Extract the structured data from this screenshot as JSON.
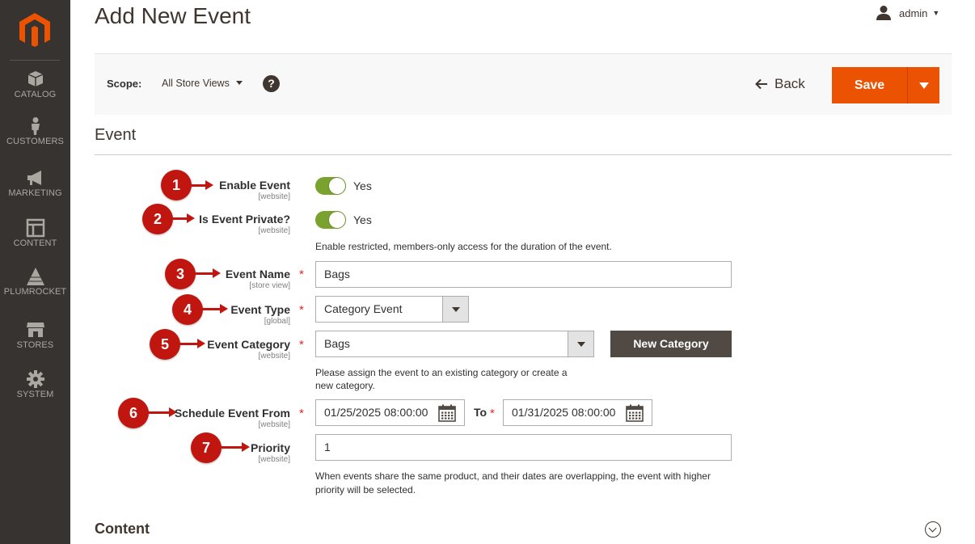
{
  "sidebar": {
    "items": [
      {
        "label": "CATALOG",
        "icon": "catalog-box-icon"
      },
      {
        "label": "CUSTOMERS",
        "icon": "customers-person-icon"
      },
      {
        "label": "MARKETING",
        "icon": "marketing-megaphone-icon"
      },
      {
        "label": "CONTENT",
        "icon": "content-layout-icon"
      },
      {
        "label": "PLUMROCKET",
        "icon": "plumrocket-pyramid-icon"
      },
      {
        "label": "STORES",
        "icon": "stores-shop-icon"
      },
      {
        "label": "SYSTEM",
        "icon": "system-gear-icon"
      }
    ],
    "colors": {
      "bg": "#373330",
      "logo": "#eb5202"
    }
  },
  "header": {
    "title": "Add New Event",
    "user": "admin"
  },
  "scope_bar": {
    "label": "Scope:",
    "value": "All Store Views",
    "back_label": "Back",
    "save_label": "Save"
  },
  "section": {
    "title": "Event"
  },
  "fields": {
    "enable_event": {
      "badge": "1",
      "label": "Enable Event",
      "scope": "[website]",
      "value": "Yes"
    },
    "is_private": {
      "badge": "2",
      "label": "Is Event Private?",
      "scope": "[website]",
      "value": "Yes",
      "note": "Enable restricted, members-only access for the duration of the event."
    },
    "event_name": {
      "badge": "3",
      "label": "Event Name",
      "scope": "[store view]",
      "value": "Bags"
    },
    "event_type": {
      "badge": "4",
      "label": "Event Type",
      "scope": "[global]",
      "value": "Category Event"
    },
    "event_category": {
      "badge": "5",
      "label": "Event Category",
      "scope": "[website]",
      "value": "Bags",
      "button": "New Category",
      "note_line1": "Please assign the event to an existing category or create a",
      "note_line2": "new category."
    },
    "schedule": {
      "badge": "6",
      "label": "Schedule Event From",
      "scope": "[website]",
      "from": "01/25/2025 08:00:00",
      "to_label": "To",
      "to": "01/31/2025 08:00:00"
    },
    "priority": {
      "badge": "7",
      "label": "Priority",
      "scope": "[website]",
      "value": "1",
      "note_line1": "When events share the same product, and their dates are overlapping, the event with higher",
      "note_line2": "priority will be selected."
    }
  },
  "content_section": {
    "title": "Content"
  },
  "required_mark": "*",
  "colors": {
    "accent": "#eb5202",
    "badge": "#c0160f",
    "toggle_on": "#79a22e",
    "dark_button": "#514943"
  }
}
